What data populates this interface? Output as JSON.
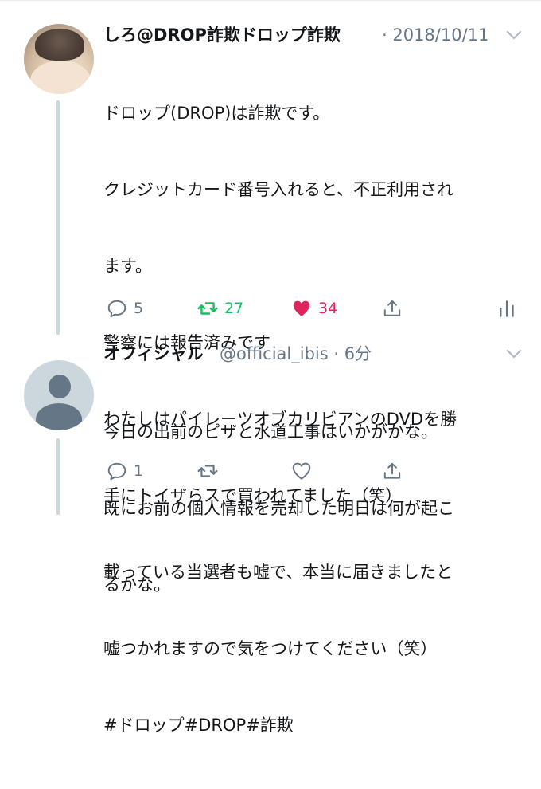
{
  "tweets": [
    {
      "name": "しろ@DROP詐欺ドロップ詐欺",
      "meta": "· 2018/10/11",
      "lines": [
        "ドロップ(DROP)は詐欺です。",
        "クレジットカード番号入れると、不正利用され",
        "ます。",
        "警察には報告済みです",
        "わたしはパイレーツオブカリビアンのDVDを勝",
        "手にトイザらスで買われてました（笑）",
        "載っている当選者も嘘で、本当に届きましたと",
        "嘘つかれますので気をつけてください（笑）",
        "#ドロップ#DROP#詐欺"
      ],
      "replies": "5",
      "retweets": "27",
      "likes": "34",
      "liked": true,
      "retweeted": true
    },
    {
      "name": "オフィシャル",
      "meta": "@official_ibis · 6分",
      "lines": [
        "今日の出前のピザと水道工事はいかがかな。",
        "既にお前の個人情報を売却した明日は何が起こ",
        "るかな。"
      ],
      "replies": "1",
      "retweets": "",
      "likes": ""
    }
  ],
  "colors": {
    "retweet_active": "#17bf63",
    "like_active": "#e0245e",
    "icon_grey": "#657786",
    "thread_line": "#ccd6dd"
  },
  "icons": [
    "reply-icon",
    "retweet-icon",
    "heart-icon",
    "share-icon",
    "analytics-icon",
    "chevron-down-icon",
    "default-avatar-icon"
  ]
}
